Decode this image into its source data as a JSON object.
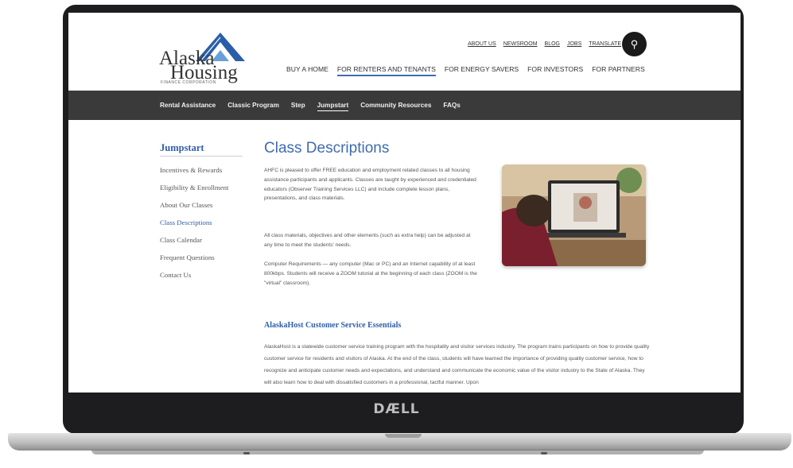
{
  "device": {
    "brand_logo": "DÆLL"
  },
  "site": {
    "logo": {
      "line1": "Alaska",
      "line2": "Housing",
      "line3": "FINANCE CORPORATION"
    },
    "utility_nav": [
      "ABOUT US",
      "NEWSROOM",
      "BLOG",
      "JOBS",
      "TRANSLATE"
    ],
    "search_icon": "search-icon",
    "main_nav": [
      "BUY A HOME",
      "FOR RENTERS AND TENANTS",
      "FOR ENERGY SAVERS",
      "FOR INVESTORS",
      "FOR PARTNERS"
    ],
    "main_nav_active": "FOR RENTERS AND TENANTS",
    "sub_nav": [
      "Rental Assistance",
      "Classic Program",
      "Step",
      "Jumpstart",
      "Community Resources",
      "FAQs"
    ],
    "sub_nav_active": "Jumpstart",
    "colors": {
      "accent": "#3f6bb0",
      "subnav_bg": "#3a3a3a",
      "logo_blue": "#2a5ea8"
    }
  },
  "sidebar": {
    "title": "Jumpstart",
    "items": [
      "Incentives & Rewards",
      "Eligibility & Enrollment",
      "About Our Classes",
      "Class Descriptions",
      "Class Calendar",
      "Frequent Questions",
      "Contact Us"
    ],
    "current": "Class Descriptions"
  },
  "content": {
    "title": "Class Descriptions",
    "paragraph1": "AHFC is pleased to offer FREE education and employment related classes to all housing assistance participants and applicants. Classes are taught by experienced and credentialed educators (Observer Training Services LLC) and include complete lesson plans, presentations, and class materials.",
    "paragraph2": "All class materials, objectives and other elements (such as extra help) can be adjusted at any time to meet the students' needs.",
    "paragraph3": "Computer Requirements — any computer (Mac or PC) and an Internet capability of at least 800kbps. Students will receive a ZOOM tutorial at the beginning of each class (ZOOM is the \"virtual\" classroom).",
    "section_heading": "AlaskaHost Customer Service Essentials",
    "section_text": "AlaskaHost is a statewide customer service training program with the hospitality and visitor services industry. The program trains participants on how to provide quality customer service for residents and visitors of Alaska. At the end of the class, students will have learned the importance of providing quality customer service, how to recognize and anticipate customer needs and expectations, and understand and communicate the economic value of the visitor industry to the State of Alaska. They will also learn how to deal with dissatisfied customers in a professional, tactful manner. Upon"
  }
}
